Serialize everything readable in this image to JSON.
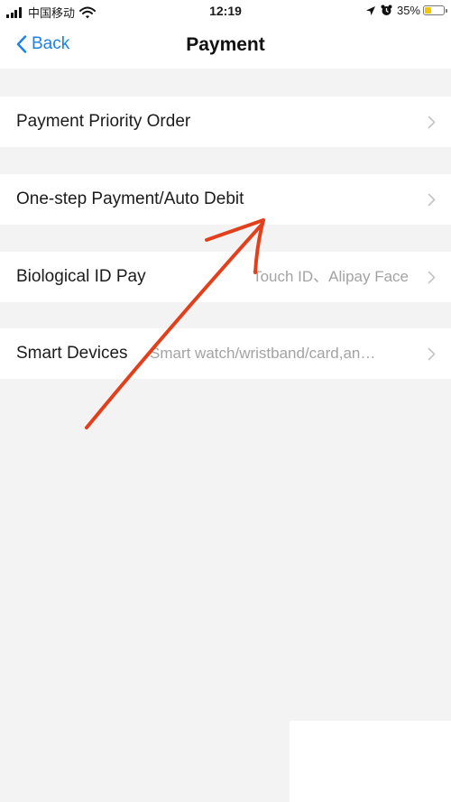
{
  "status_bar": {
    "carrier": "中国移动",
    "time": "12:19",
    "battery_percent": "35%",
    "battery_level": 0.35,
    "icons": [
      "signal-icon",
      "wifi-icon",
      "location-icon",
      "alarm-icon",
      "battery-icon"
    ]
  },
  "nav": {
    "back_label": "Back",
    "title": "Payment"
  },
  "rows": [
    {
      "label": "Payment Priority Order",
      "value": ""
    },
    {
      "label": "One-step Payment/Auto Debit",
      "value": ""
    },
    {
      "label": "Biological ID Pay",
      "value": "Touch ID、Alipay Face"
    },
    {
      "label": "Smart Devices",
      "value": "Smart watch/wristband/card,an…"
    }
  ],
  "colors": {
    "accent": "#1a82e6",
    "background": "#f3f3f3",
    "annotation": "#e2401c"
  }
}
